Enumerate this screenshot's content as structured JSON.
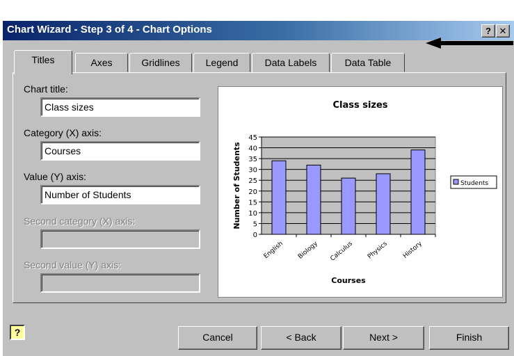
{
  "window": {
    "title": "Chart Wizard - Step 3 of 4 - Chart Options",
    "help_glyph": "?",
    "close_glyph": "✕"
  },
  "tabs": [
    {
      "label": "Titles",
      "active": true
    },
    {
      "label": "Axes",
      "active": false
    },
    {
      "label": "Gridlines",
      "active": false
    },
    {
      "label": "Legend",
      "active": false
    },
    {
      "label": "Data Labels",
      "active": false
    },
    {
      "label": "Data Table",
      "active": false
    }
  ],
  "form": {
    "chart_title_label": "Chart title:",
    "chart_title_value": "Class sizes",
    "category_x_label": "Category (X) axis:",
    "category_x_value": "Courses",
    "value_y_label": "Value (Y) axis:",
    "value_y_value": "Number of Students",
    "second_category_label": "Second category (X) axis:",
    "second_category_value": "",
    "second_value_label": "Second value (Y) axis:",
    "second_value_value": ""
  },
  "chart_data": {
    "type": "bar",
    "title": "Class sizes",
    "xlabel": "Courses",
    "ylabel": "Number of Students",
    "categories": [
      "English",
      "Biology",
      "Calculus",
      "Physics",
      "History"
    ],
    "series": [
      {
        "name": "Students",
        "values": [
          34,
          32,
          26,
          28,
          39
        ],
        "color": "#9999ff"
      }
    ],
    "ylim": [
      0,
      45
    ],
    "yticks": [
      0,
      5,
      10,
      15,
      20,
      25,
      30,
      35,
      40,
      45
    ],
    "grid": true,
    "legend": "right",
    "plot_background": "#c0c0c0"
  },
  "buttons": {
    "help_icon": "?",
    "cancel": "Cancel",
    "back": "< Back",
    "next": "Next >",
    "finish": "Finish"
  }
}
